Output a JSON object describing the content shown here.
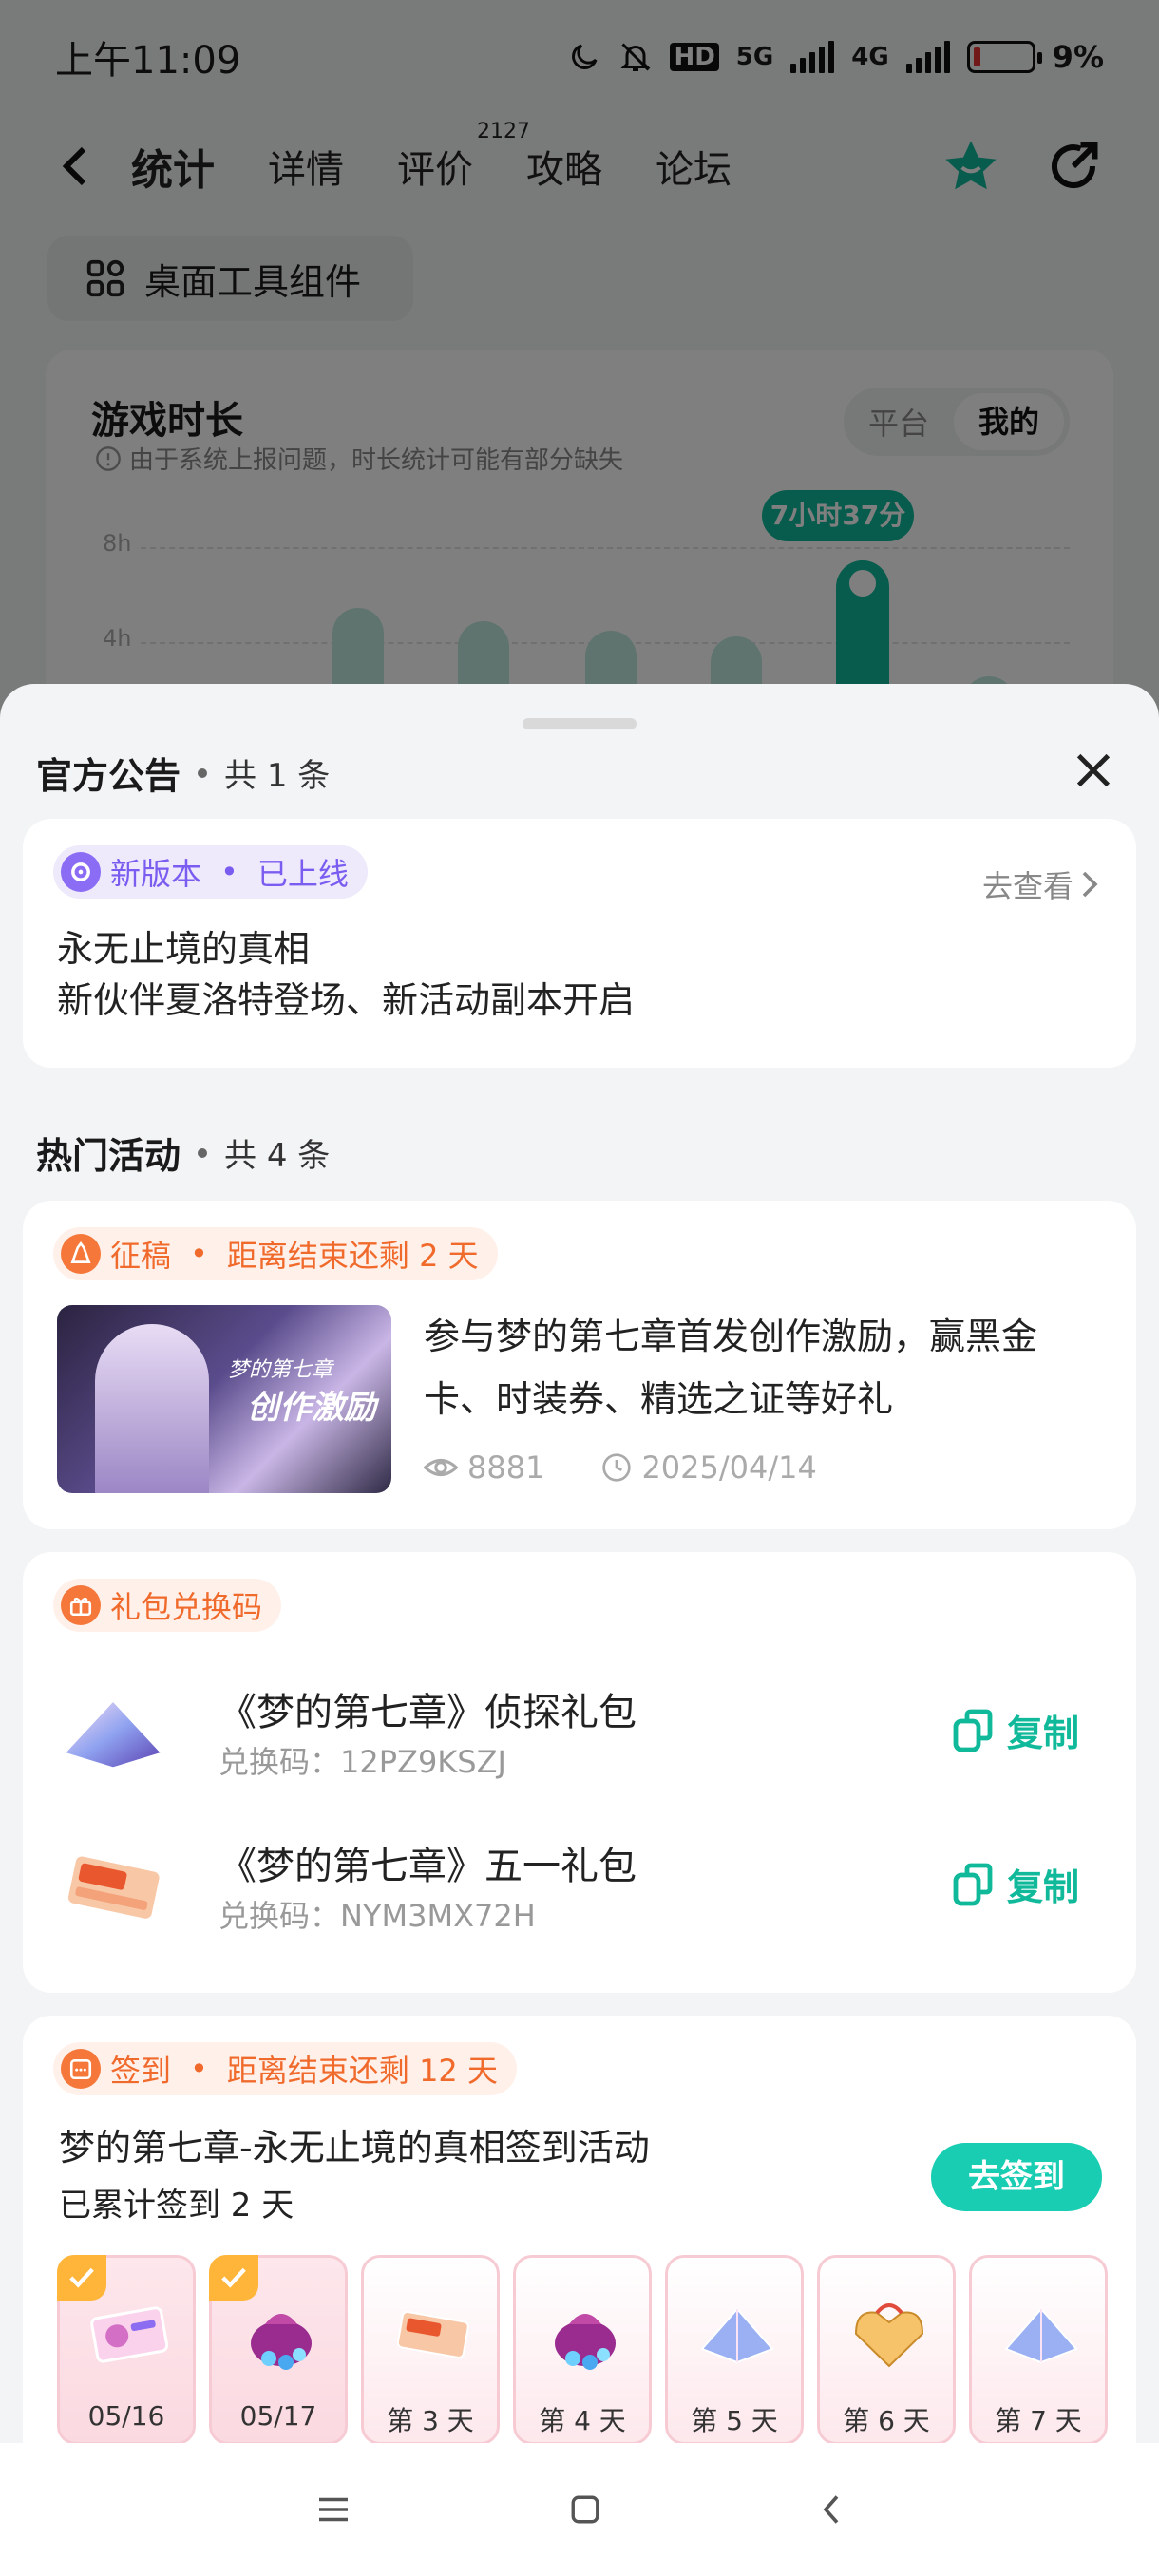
{
  "status_bar": {
    "time": "上午11:09",
    "battery": "9%",
    "net1": "5G",
    "net2": "4G",
    "hd": "HD"
  },
  "top_nav": {
    "tabs": [
      {
        "label": "统计"
      },
      {
        "label": "详情"
      },
      {
        "label": "评价",
        "badge": "2127"
      },
      {
        "label": "攻略"
      },
      {
        "label": "论坛"
      }
    ],
    "active_tab": "统计"
  },
  "widget_button": {
    "label": "桌面工具组件"
  },
  "game_time": {
    "title": "游戏时长",
    "notice": "由于系统上报问题，时长统计可能有部分缺失",
    "segments": [
      "平台",
      "我的"
    ],
    "selected_segment": "我的",
    "gridlines": [
      "8h",
      "4h"
    ],
    "peak_label": "7小时37分钟"
  },
  "sheet": {
    "announcement": {
      "title": "官方公告",
      "count": "共 1 条",
      "tag": "新版本",
      "status": "已上线",
      "link": "去查看",
      "line1": "永无止境的真相",
      "line2": "新伙伴夏洛特登场、新活动副本开启"
    },
    "activities": {
      "title": "热门活动",
      "count": "共 4 条",
      "contest": {
        "tag": "征稿",
        "remaining": "距离结束还剩 2 天",
        "title": "参与梦的第七章首发创作激励，赢黑金卡、时装券、精选之证等好礼",
        "views": "8881",
        "date": "2025/04/14",
        "thumb_text_1": "梦的第七章",
        "thumb_text_2": "创作激励"
      },
      "gift": {
        "tag": "礼包兑换码",
        "items": [
          {
            "name": "《梦的第七章》侦探礼包",
            "code": "兑换码：12PZ9KSZJ",
            "action": "复制"
          },
          {
            "name": "《梦的第七章》五一礼包",
            "code": "兑换码：NYM3MX72H",
            "action": "复制"
          }
        ]
      },
      "signin": {
        "tag": "签到",
        "remaining": "距离结束还剩 12 天",
        "title": "梦的第七章-永无止境的真相签到活动",
        "count": "已累计签到 2 天",
        "button": "去签到",
        "days": [
          {
            "label": "05/16",
            "done": true,
            "icon": "ticket-icon"
          },
          {
            "label": "05/17",
            "done": true,
            "icon": "gem-bag-icon"
          },
          {
            "label": "第 3 天",
            "done": false,
            "icon": "card-icon"
          },
          {
            "label": "第 4 天",
            "done": false,
            "icon": "gem-bag-icon"
          },
          {
            "label": "第 5 天",
            "done": false,
            "icon": "crystal-icon"
          },
          {
            "label": "第 6 天",
            "done": false,
            "icon": "gift-box-icon"
          },
          {
            "label": "第 7 天",
            "done": false,
            "icon": "crystal-icon"
          }
        ]
      }
    }
  },
  "colors": {
    "accent": "#10b99a",
    "orange": "#f06a2c",
    "purple": "#7a5cf0"
  }
}
